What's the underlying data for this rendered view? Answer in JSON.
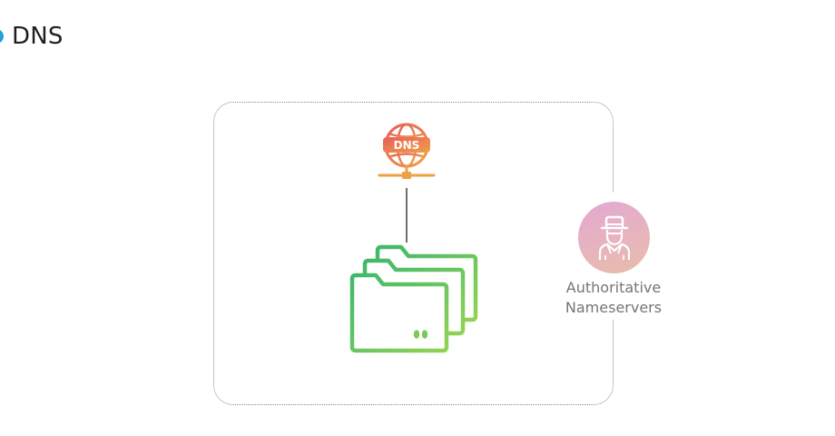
{
  "header": {
    "title": "DNS"
  },
  "diagram": {
    "server_icon_text": "DNS",
    "nameserver_label_line1": "Authoritative",
    "nameserver_label_line2": "Nameservers"
  },
  "colors": {
    "title_dot": "#1fa2d6",
    "dns_icon_top": "#e85d5d",
    "dns_icon_bottom": "#f0a046",
    "folder_gradient_start": "#3fb86c",
    "folder_gradient_end": "#92d256",
    "avatar_gradient": "#e3a8d2"
  },
  "icons": {
    "server": "dns-server-icon",
    "folders": "folders-icon",
    "nameserver": "hacker-person-icon"
  }
}
